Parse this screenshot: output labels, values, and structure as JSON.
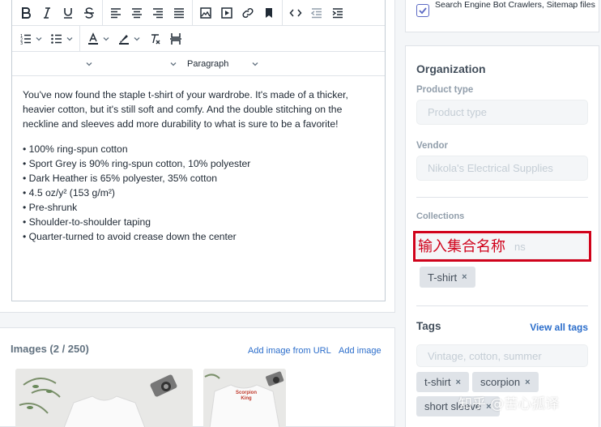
{
  "editor": {
    "toolbar_row1": [
      "bold-icon",
      "italic-icon",
      "underline-icon",
      "strikethrough-icon",
      "align-left-icon",
      "align-center-icon",
      "align-right-icon",
      "align-justify-icon",
      "image-icon",
      "video-icon",
      "link-icon",
      "bookmark-icon",
      "code-icon",
      "outdent-icon",
      "indent-icon"
    ],
    "toolbar_row2": [
      "ordered-list-icon",
      "bulleted-list-icon",
      "text-color-icon",
      "highlight-color-icon",
      "clear-formatting-icon",
      "page-break-icon"
    ],
    "format_select": "Paragraph",
    "paragraph": "You've now found the staple t-shirt of your wardrobe. It's made of a thicker, heavier cotton, but it's still soft and comfy. And the double stitching on the neckline and sleeves add more durability to what is sure to be a favorite!",
    "bullets": [
      "• 100% ring-spun cotton",
      "• Sport Grey is 90% ring-spun cotton, 10% polyester",
      "• Dark Heather is 65% polyester, 35% cotton",
      "• 4.5 oz/y² (153 g/m²)",
      "• Pre-shrunk",
      "• Shoulder-to-shoulder taping",
      "• Quarter-turned to avoid crease down the center"
    ]
  },
  "images": {
    "title": "Images (2 / 250)",
    "add_from_url": "Add image from URL",
    "add_image": "Add image",
    "thumb2_caption": "Scorpion King"
  },
  "seo": {
    "checkbox_label": "Search Engine Bot Crawlers, Sitemap files",
    "checked": true
  },
  "organization": {
    "heading": "Organization",
    "product_type_label": "Product type",
    "product_type_placeholder": "Product type",
    "vendor_label": "Vendor",
    "vendor_placeholder": "Nikola's Electrical Supplies",
    "collections_label": "Collections",
    "collections_placeholder": "Search for collections",
    "collection_tags": [
      "T-shirt"
    ],
    "tags_label": "Tags",
    "view_all_tags": "View all tags",
    "tags_placeholder": "Vintage, cotton, summer",
    "tags": [
      "t-shirt",
      "scorpion",
      "short sleeve"
    ]
  },
  "annotation": {
    "text": "输入集合名称",
    "color": "#d0021b"
  },
  "watermark": "知乎 @苦心孤译",
  "colors": {
    "link": "#2c6ecb",
    "checkbox": "#5c6ac4"
  }
}
